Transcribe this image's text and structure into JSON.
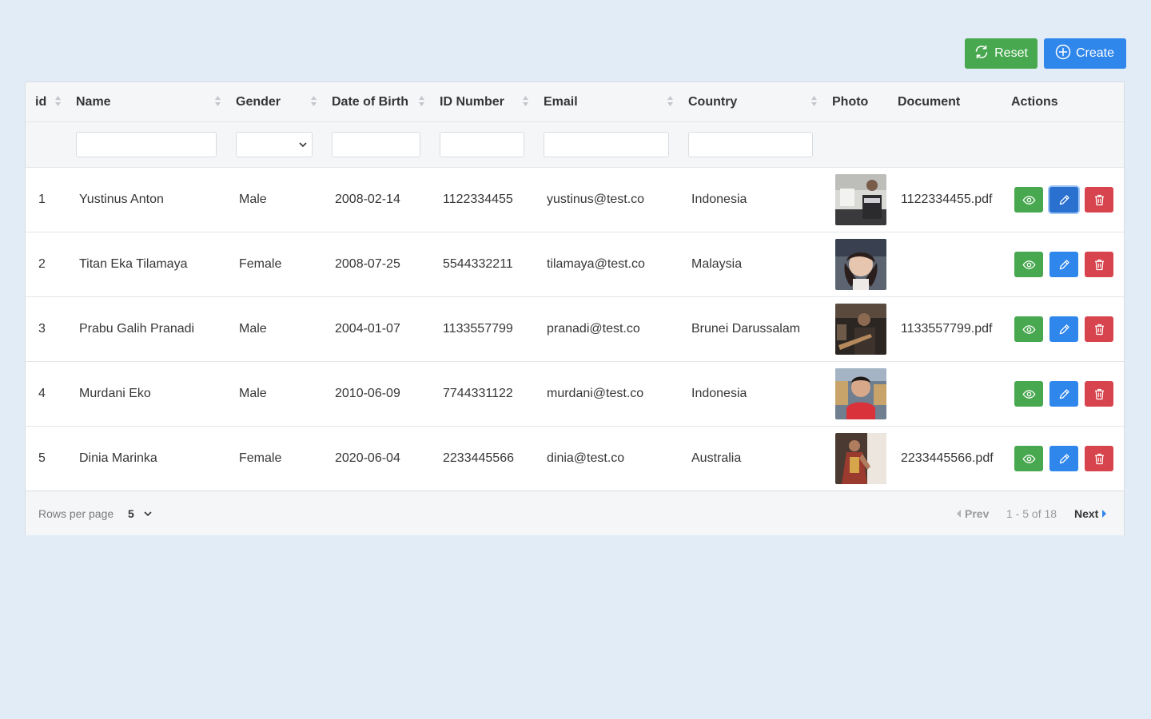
{
  "toolbar": {
    "reset_label": "Reset",
    "create_label": "Create"
  },
  "colors": {
    "green": "#48a84f",
    "blue": "#2f86eb",
    "red": "#d7444d",
    "background": "#e2ecf6"
  },
  "columns": [
    "id",
    "Name",
    "Gender",
    "Date of Birth",
    "ID Number",
    "Email",
    "Country",
    "Photo",
    "Document",
    "Actions"
  ],
  "filters": {
    "gender_selected": ""
  },
  "rows": [
    {
      "id": "1",
      "name": "Yustinus Anton",
      "gender": "Male",
      "dob": "2008-02-14",
      "id_number": "1122334455",
      "email": "yustinus@test.co",
      "country": "Indonesia",
      "document": "1122334455.pdf"
    },
    {
      "id": "2",
      "name": "Titan Eka Tilamaya",
      "gender": "Female",
      "dob": "2008-07-25",
      "id_number": "5544332211",
      "email": "tilamaya@test.co",
      "country": "Malaysia",
      "document": ""
    },
    {
      "id": "3",
      "name": "Prabu Galih Pranadi",
      "gender": "Male",
      "dob": "2004-01-07",
      "id_number": "1133557799",
      "email": "pranadi@test.co",
      "country": "Brunei Darussalam",
      "document": "1133557799.pdf"
    },
    {
      "id": "4",
      "name": "Murdani Eko",
      "gender": "Male",
      "dob": "2010-06-09",
      "id_number": "7744331122",
      "email": "murdani@test.co",
      "country": "Indonesia",
      "document": ""
    },
    {
      "id": "5",
      "name": "Dinia Marinka",
      "gender": "Female",
      "dob": "2020-06-04",
      "id_number": "2233445566",
      "email": "dinia@test.co",
      "country": "Australia",
      "document": "2233445566.pdf"
    }
  ],
  "pagination": {
    "rows_per_page_label": "Rows per page",
    "rows_per_page_value": "5",
    "prev_label": "Prev",
    "range_text": "1 - 5 of 18",
    "next_label": "Next"
  }
}
